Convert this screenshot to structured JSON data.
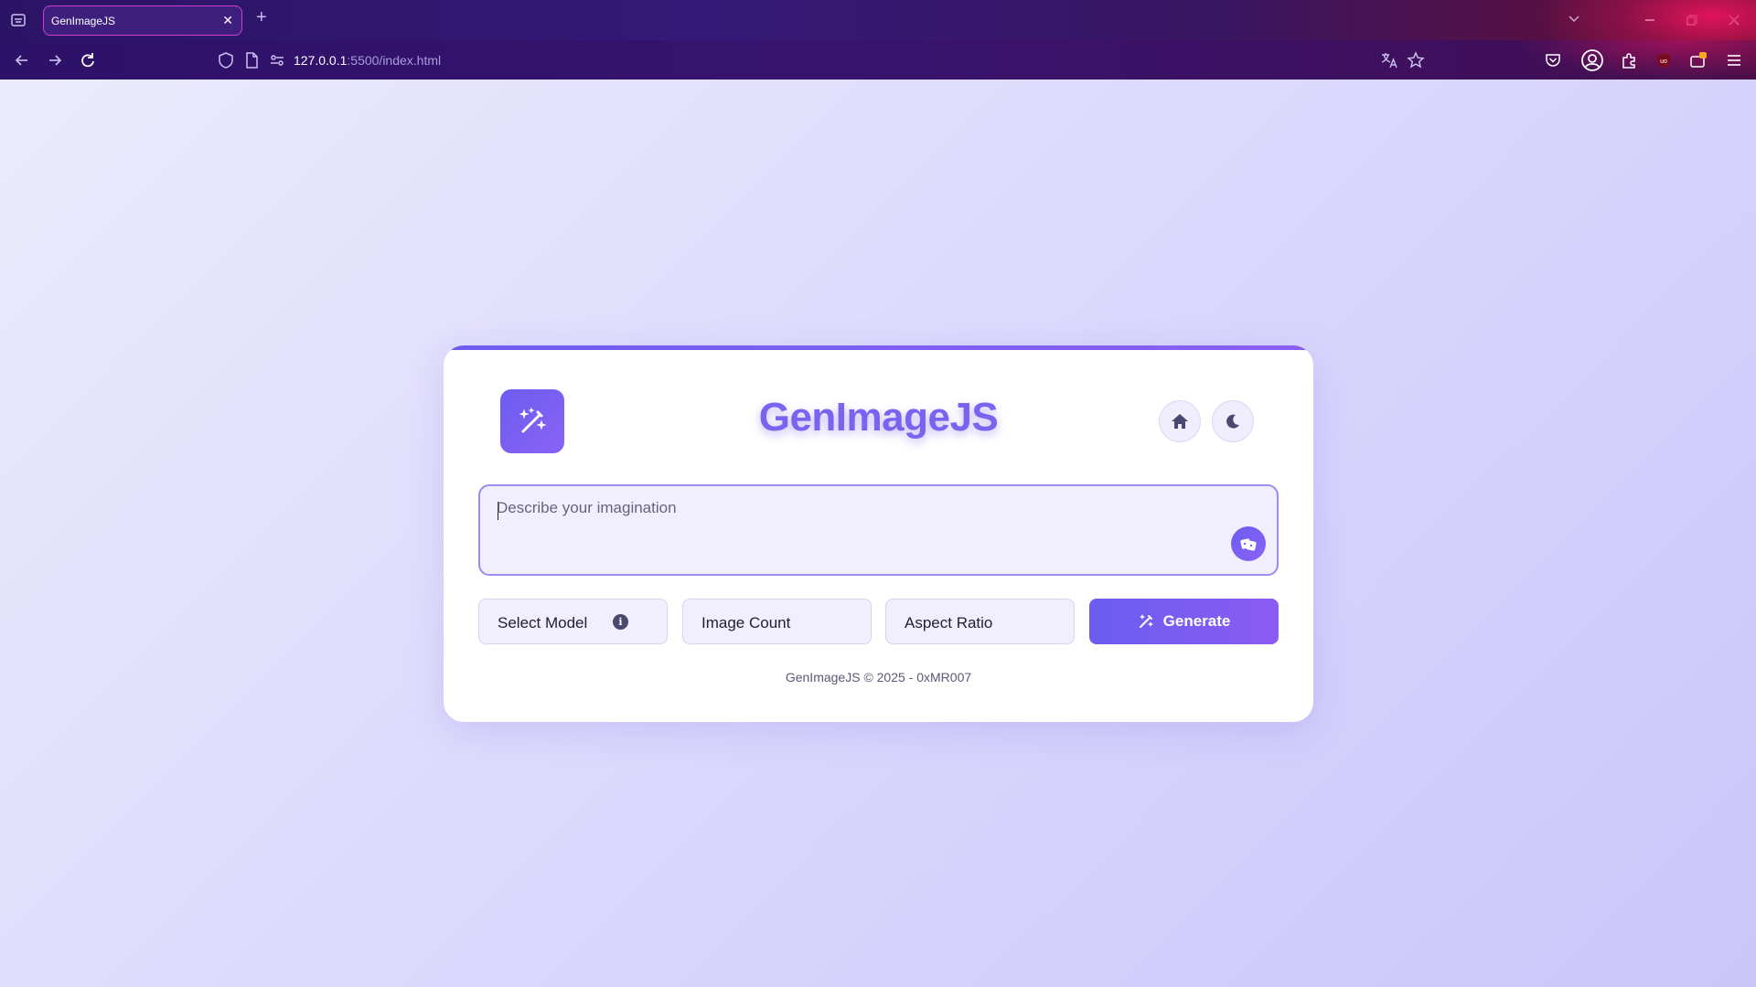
{
  "browser": {
    "tab_title": "GenImageJS",
    "tab_close": "✕",
    "new_tab": "+",
    "url_host": "127.0.0.1",
    "url_path": ":5500/index.html"
  },
  "app": {
    "title": "GenImageJS",
    "prompt_placeholder": "Describe your imagination",
    "select_model_label": "Select Model",
    "info_icon_glyph": "i",
    "image_count_label": "Image Count",
    "aspect_ratio_label": "Aspect Ratio",
    "generate_label": "Generate",
    "footer": "GenImageJS © 2025 - 0xMR007"
  },
  "colors": {
    "accent": "#6b5cf0",
    "accent_2": "#8a63f5",
    "page_bg": "#dcdcfa"
  }
}
